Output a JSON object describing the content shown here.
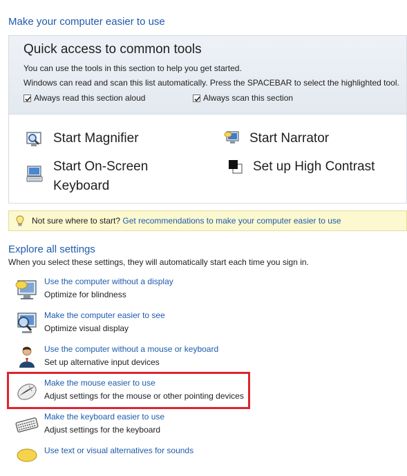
{
  "page": {
    "title": "Make your computer easier to use"
  },
  "quick_access": {
    "title": "Quick access to common tools",
    "line1": "You can use the tools in this section to help you get started.",
    "line2": "Windows can read and scan this list automatically.  Press the SPACEBAR to select the highlighted tool.",
    "read_aloud": {
      "label": "Always read this section aloud",
      "checked": true
    },
    "scan": {
      "label": "Always scan this section",
      "checked": true
    },
    "tools": [
      {
        "label": "Start Magnifier",
        "icon": "magnifier-icon"
      },
      {
        "label": "Start Narrator",
        "icon": "narrator-icon"
      },
      {
        "label": "Start On-Screen",
        "label2": "Keyboard",
        "icon": "on-screen-keyboard-icon"
      },
      {
        "label": "Set up High Contrast",
        "icon": "high-contrast-icon"
      }
    ]
  },
  "tip": {
    "prefix": "Not sure where to start?",
    "link": "Get recommendations to make your computer easier to use",
    "icon": "lightbulb-icon"
  },
  "explore": {
    "title": "Explore all settings",
    "description": "When you select these settings, they will automatically start each time you sign in.",
    "settings": [
      {
        "link": "Use the computer without a display",
        "desc": "Optimize for blindness",
        "icon": "speech-display-icon"
      },
      {
        "link": "Make the computer easier to see",
        "desc": "Optimize visual display",
        "icon": "magnified-display-icon"
      },
      {
        "link": "Use the computer without a mouse or keyboard",
        "desc": "Set up alternative input devices",
        "icon": "user-input-icon"
      },
      {
        "link": "Make the mouse easier to use",
        "desc": "Adjust settings for the mouse or other pointing devices",
        "icon": "mouse-icon",
        "highlighted": true
      },
      {
        "link": "Make the keyboard easier to use",
        "desc": "Adjust settings for the keyboard",
        "icon": "keyboard-icon"
      },
      {
        "link": "Use text or visual alternatives for sounds",
        "desc": "",
        "icon": "sound-alternatives-icon"
      }
    ]
  },
  "colors": {
    "link": "#1e5bab",
    "highlight": "#e0222e",
    "tip_background": "#fcf8cf"
  }
}
